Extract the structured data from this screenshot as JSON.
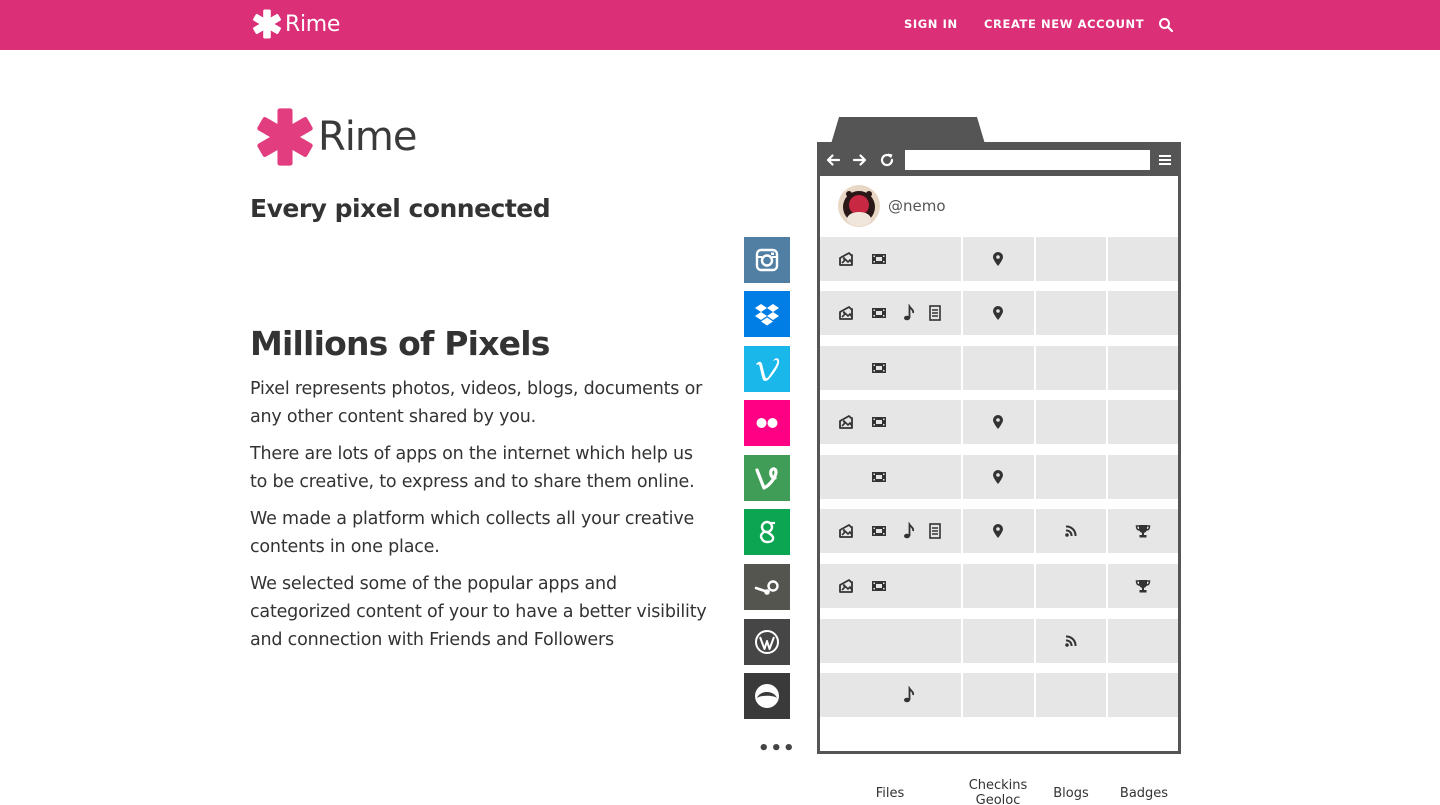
{
  "navbar": {
    "brand": "Rime",
    "sign_in": "SIGN IN",
    "create_account": "CREATE NEW ACCOUNT",
    "search_icon": "search-icon",
    "color": "#db2f78"
  },
  "hero": {
    "logo_text": "Rime",
    "tagline": "Every pixel connected",
    "title": "Millions of Pixels",
    "paragraphs": [
      "Pixel represents photos, videos, blogs, documents or any other content shared by you.",
      "There are lots of apps on the internet which help us to be creative, to express and to share them online.",
      "We made a platform which collects all your creative contents in one place.",
      "We selected some of the popular apps and categorized content of your to have a better visibility and connection with Friends and Followers"
    ]
  },
  "illustration": {
    "username": "@nemo",
    "columns": [
      "Files",
      "Checkins Geoloc",
      "Blogs",
      "Badges"
    ],
    "apps": [
      {
        "name": "instagram",
        "color": "#517fa4",
        "files": [
          "photo",
          "video"
        ],
        "checkin": true,
        "blog": false,
        "badge": false
      },
      {
        "name": "dropbox",
        "color": "#007ee5",
        "files": [
          "photo",
          "video",
          "music",
          "document"
        ],
        "checkin": true,
        "blog": false,
        "badge": false
      },
      {
        "name": "vimeo",
        "color": "#1ab7ea",
        "files": [
          "video"
        ],
        "checkin": false,
        "blog": false,
        "badge": false
      },
      {
        "name": "flickr",
        "color": "#ff0084",
        "files": [
          "photo",
          "video"
        ],
        "checkin": true,
        "blog": false,
        "badge": false
      },
      {
        "name": "vine",
        "color": "#3f9d57",
        "files": [
          "video"
        ],
        "checkin": true,
        "blog": false,
        "badge": false
      },
      {
        "name": "google-plus",
        "color": "#0ca552",
        "files": [
          "photo",
          "video",
          "music",
          "document"
        ],
        "checkin": true,
        "blog": true,
        "badge": true
      },
      {
        "name": "steam",
        "color": "#555550",
        "files": [
          "photo",
          "video"
        ],
        "checkin": false,
        "blog": false,
        "badge": true
      },
      {
        "name": "wordpress",
        "color": "#464646",
        "files": [],
        "checkin": false,
        "blog": true,
        "badge": false
      },
      {
        "name": "grooveshark",
        "color": "#3a3a3a",
        "files": [
          "music"
        ],
        "checkin": false,
        "blog": false,
        "badge": false
      }
    ],
    "more": "•••"
  }
}
